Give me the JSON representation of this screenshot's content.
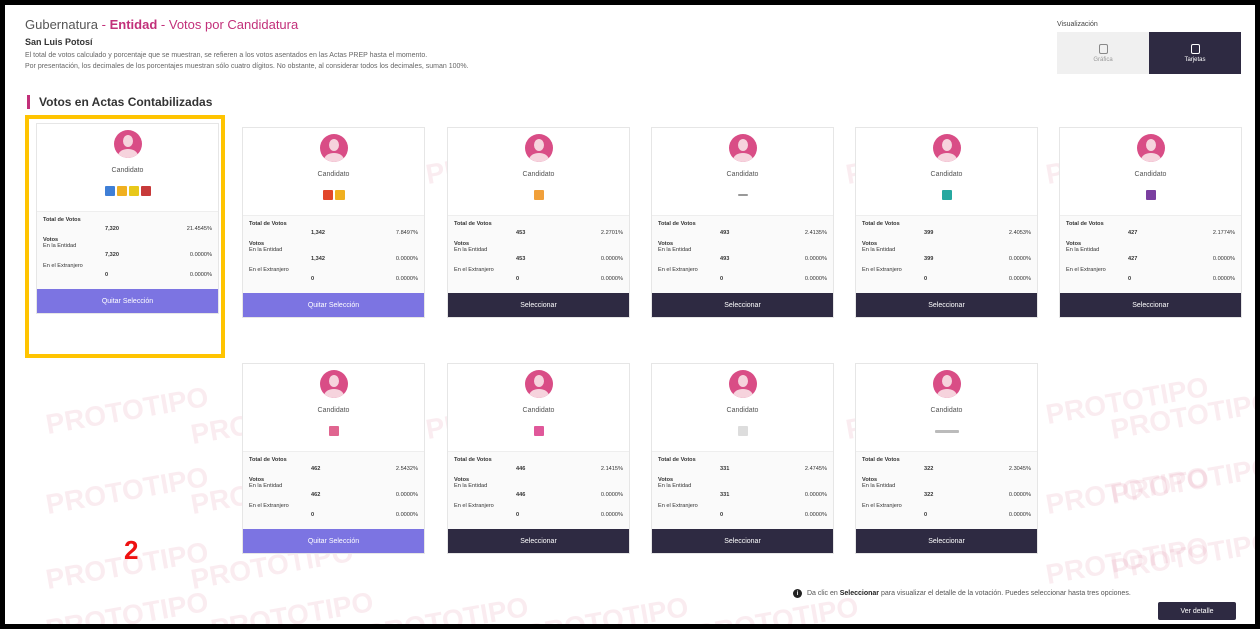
{
  "breadcrumb": {
    "level1": "Gubernatura",
    "separator": "-",
    "level2": "Entidad",
    "level3": "Votos por Candidatura"
  },
  "state_name": "San Luis Potosí",
  "notes": [
    "El total de votos calculado y porcentaje que se muestran, se refieren a los votos asentados en las Actas PREP hasta el momento.",
    "Por presentación, los decimales de los porcentajes muestran sólo cuatro dígitos. No obstante, al considerar todos los decimales, suman 100%."
  ],
  "section_title": "Votos en Actas Contabilizadas",
  "visualization": {
    "label": "Visualización",
    "options": [
      {
        "label": "Gráfica",
        "active": false,
        "icon": "chart-icon"
      },
      {
        "label": "Tarjetas",
        "active": true,
        "icon": "cards-icon"
      }
    ]
  },
  "stat_labels": {
    "total": "Total de Votos",
    "votos": "Votos",
    "entidad": "En la Entidad",
    "extranjero": "En el Extranjero"
  },
  "watermark": "PROTOTIPO",
  "candidates": [
    {
      "name": "Candidato",
      "logos": [
        "#3f7fd6",
        "#f0b020",
        "#e8c81a",
        "#c73a3a"
      ],
      "total": "7,320",
      "total_pct": "21.4545%",
      "entidad": "7,320",
      "entidad_pct": "0.0000%",
      "extranjero": "0",
      "extranjero_pct": "0.0000%",
      "button": "Quitar Selección",
      "selected": true
    },
    {
      "name": "Candidato",
      "logos": [
        "#e2462b",
        "#f0b020"
      ],
      "total": "1,342",
      "total_pct": "7.8497%",
      "entidad": "1,342",
      "entidad_pct": "0.0000%",
      "extranjero": "0",
      "extranjero_pct": "0.0000%",
      "button": "Quitar Selección",
      "selected": true
    },
    {
      "name": "Candidato",
      "logos": [
        "#f1a03a"
      ],
      "total": "453",
      "total_pct": "2.2701%",
      "entidad": "453",
      "entidad_pct": "0.0000%",
      "extranjero": "0",
      "extranjero_pct": "0.0000%",
      "button": "Seleccionar",
      "selected": false
    },
    {
      "name": "Candidato",
      "logos": [
        "dash"
      ],
      "total": "493",
      "total_pct": "2.4135%",
      "entidad": "493",
      "entidad_pct": "0.0000%",
      "extranjero": "0",
      "extranjero_pct": "0.0000%",
      "button": "Seleccionar",
      "selected": false
    },
    {
      "name": "Candidato",
      "logos": [
        "#26a8a0"
      ],
      "total": "399",
      "total_pct": "2.4053%",
      "entidad": "399",
      "entidad_pct": "0.0000%",
      "extranjero": "0",
      "extranjero_pct": "0.0000%",
      "button": "Seleccionar",
      "selected": false
    },
    {
      "name": "Candidato",
      "logos": [
        "#7b3fa0"
      ],
      "total": "427",
      "total_pct": "2.1774%",
      "entidad": "427",
      "entidad_pct": "0.0000%",
      "extranjero": "0",
      "extranjero_pct": "0.0000%",
      "button": "Seleccionar",
      "selected": false
    },
    {
      "name": "Candidato",
      "logos": [
        "#e06590"
      ],
      "total": "462",
      "total_pct": "2.5432%",
      "entidad": "462",
      "entidad_pct": "0.0000%",
      "extranjero": "0",
      "extranjero_pct": "0.0000%",
      "button": "Quitar Selección",
      "selected": true
    },
    {
      "name": "Candidato",
      "logos": [
        "#e0589a"
      ],
      "total": "446",
      "total_pct": "2.1415%",
      "entidad": "446",
      "entidad_pct": "0.0000%",
      "extranjero": "0",
      "extranjero_pct": "0.0000%",
      "button": "Seleccionar",
      "selected": false
    },
    {
      "name": "Candidato",
      "logos": [
        "#dddddd"
      ],
      "total": "331",
      "total_pct": "2.4745%",
      "entidad": "331",
      "entidad_pct": "0.0000%",
      "extranjero": "0",
      "extranjero_pct": "0.0000%",
      "button": "Seleccionar",
      "selected": false
    },
    {
      "name": "Candidato",
      "logos": [
        "bar"
      ],
      "total": "322",
      "total_pct": "2.3045%",
      "entidad": "322",
      "entidad_pct": "0.0000%",
      "extranjero": "0",
      "extranjero_pct": "0.0000%",
      "button": "Seleccionar",
      "selected": false
    }
  ],
  "annotation_number": "2",
  "footer": {
    "prefix": "Da clic en",
    "bold": "Seleccionar",
    "suffix": "para visualizar el detalle de la votación. Puedes seleccionar hasta tres opciones."
  },
  "detail_button": "Ver detalle"
}
